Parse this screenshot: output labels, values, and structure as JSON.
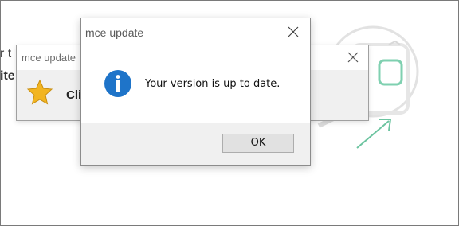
{
  "background": {
    "line1": "r t",
    "line2": "ite"
  },
  "back_dialog": {
    "title": "mce update",
    "message": "Cli",
    "icon": "star-icon",
    "close_icon": "close-icon"
  },
  "dialog": {
    "title": "mce update",
    "message": "Your version is up to date.",
    "icon": "info-icon",
    "close_icon": "close-icon",
    "ok_label": "OK"
  },
  "colors": {
    "info_blue": "#1e74c9",
    "star_gold": "#f2b521",
    "illustration_green": "#6cc4a0"
  }
}
